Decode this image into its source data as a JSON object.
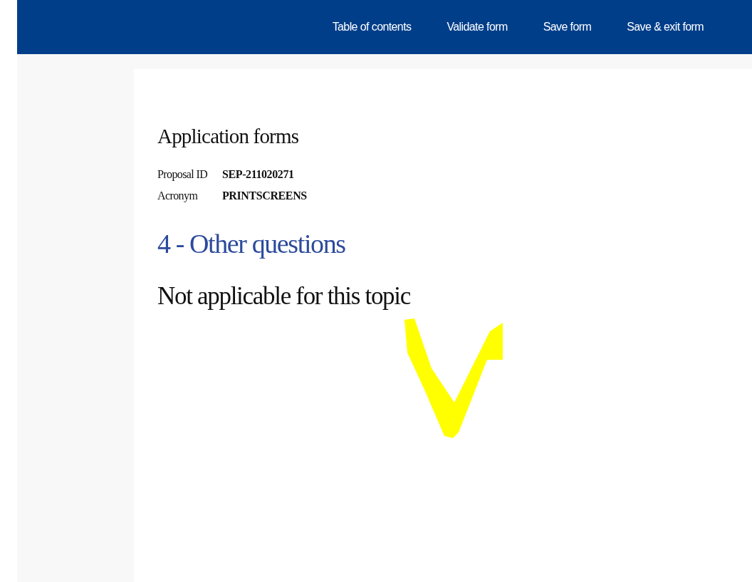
{
  "nav": [
    {
      "label": "Table of contents"
    },
    {
      "label": "Validate form"
    },
    {
      "label": "Save form"
    },
    {
      "label": "Save & exit form"
    }
  ],
  "page": {
    "title": "Application forms",
    "fields": [
      {
        "label": "Proposal ID",
        "value": "SEP-211020271"
      },
      {
        "label": "Acronym",
        "value": "PRINTSCREENS"
      }
    ],
    "section_heading": "4 - Other questions",
    "message": "Not applicable for this topic"
  }
}
